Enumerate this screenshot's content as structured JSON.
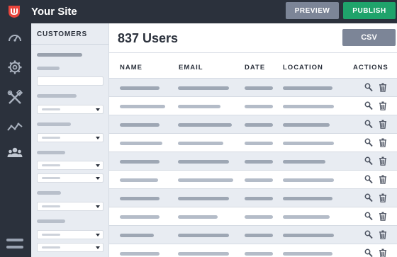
{
  "app": {
    "title": "Your Site",
    "preview_label": "PREVIEW",
    "publish_label": "PUBLISH"
  },
  "rail": {
    "icons": [
      "dashboard-icon",
      "settings-icon",
      "tools-icon",
      "analytics-icon",
      "users-icon",
      "menu-icon"
    ]
  },
  "sidebar": {
    "heading": "CUSTOMERS"
  },
  "main": {
    "heading": "837 Users",
    "csv_label": "CSV",
    "columns": [
      "NAME",
      "EMAIL",
      "DATE",
      "LOCATION",
      "ACTIONS"
    ],
    "row_count": 10
  },
  "colors": {
    "nav_bg": "#2b313c",
    "publish": "#1fa36b",
    "secondary_button": "#7c8597",
    "sidebar_bg": "#e8ecf2"
  }
}
